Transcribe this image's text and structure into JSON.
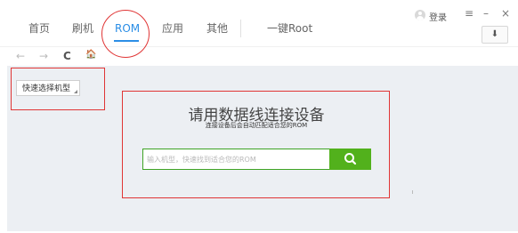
{
  "nav": {
    "tabs": [
      {
        "label": "首页"
      },
      {
        "label": "刷机"
      },
      {
        "label": "ROM"
      },
      {
        "label": "应用"
      },
      {
        "label": "其他"
      },
      {
        "label": "一键Root"
      }
    ],
    "active_tab": "ROM",
    "login_label": "登录",
    "window_controls": {
      "menu": "≡",
      "minimize": "–",
      "close": "×"
    },
    "download_symbol": "⬇"
  },
  "toolbar": {
    "back": "←",
    "forward": "→",
    "refresh": "C",
    "home": "🏠"
  },
  "main": {
    "model_select_label": "快速选择机型",
    "heading": "请用数据线连接设备",
    "subheading": "连接设备后会自动匹配适合您的ROM",
    "search": {
      "placeholder": "输入机型，快速找到适合您的ROM",
      "value": ""
    }
  },
  "colors": {
    "accent": "#2b8ee6",
    "search_button": "#52b11c",
    "annotation": "#e03535",
    "main_background": "#eceff3"
  }
}
